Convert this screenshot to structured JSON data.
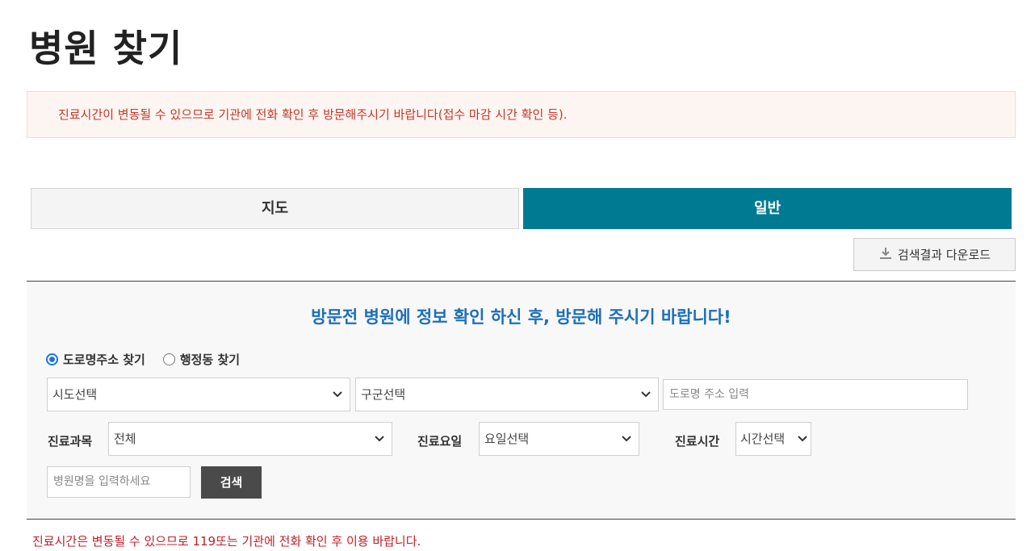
{
  "page": {
    "title": "병원 찾기"
  },
  "notice": {
    "text": "진료시간이 변동될 수 있으므로 기관에 전화 확인 후 방문해주시기 바랍니다(접수 마감 시간 확인 등)."
  },
  "tabs": [
    {
      "label": "지도",
      "active": false
    },
    {
      "label": "일반",
      "active": true
    }
  ],
  "download": {
    "label": "검색결과 다운로드",
    "icon": "download-icon"
  },
  "search": {
    "heading": "방문전 병원에 정보 확인 하신 후, 방문해 주시기 바랍니다!",
    "radio": [
      {
        "label": "도로명주소 찾기",
        "checked": true
      },
      {
        "label": "행정동 찾기",
        "checked": false
      }
    ],
    "sido": {
      "value": "시도선택"
    },
    "gugun": {
      "value": "구군선택"
    },
    "road_address": {
      "placeholder": "도로명 주소 입력"
    },
    "department": {
      "label": "진료과목",
      "value": "전체"
    },
    "weekday": {
      "label": "진료요일",
      "value": "요일선택"
    },
    "hours": {
      "label": "진료시간",
      "value": "시간선택"
    },
    "hospital_name": {
      "placeholder": "병원명을 입력하세요"
    },
    "submit_label": "검색"
  },
  "footer_note": "진료시간은 변동될 수 있으므로 119또는 기관에 전화 확인 후 이용 바랍니다.",
  "colors": {
    "accent": "#007a93",
    "heading_blue": "#1d6fb8",
    "warning_red": "#c0392b"
  }
}
